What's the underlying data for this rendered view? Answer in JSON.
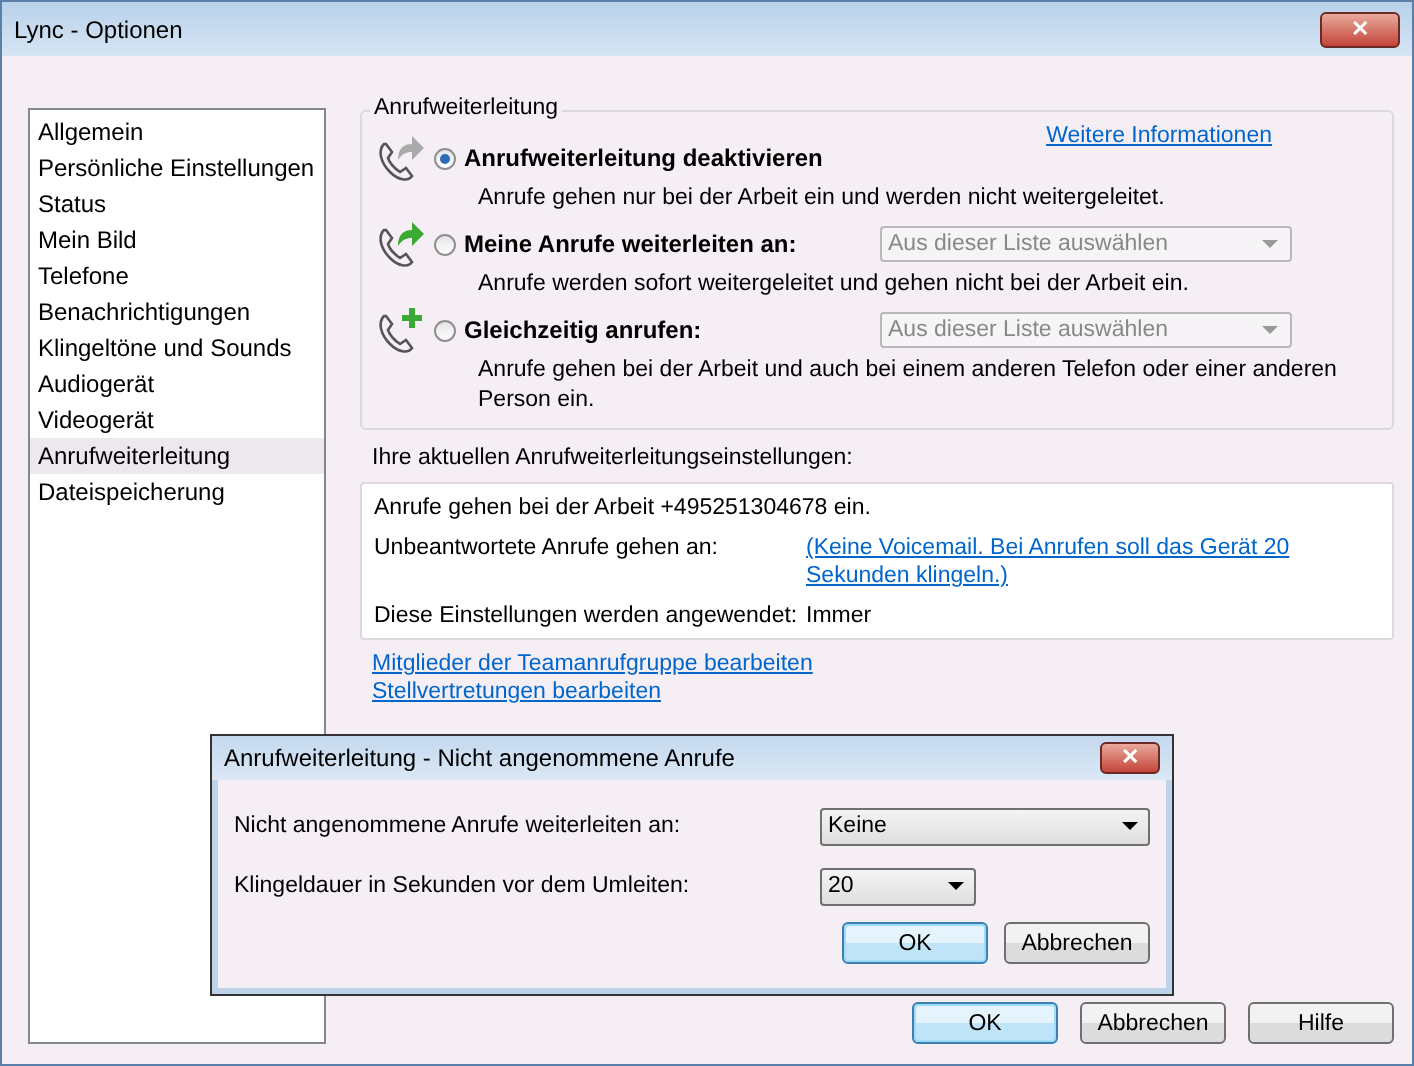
{
  "window": {
    "title": "Lync - Optionen",
    "close": "✕"
  },
  "sidebar": {
    "items": [
      {
        "label": "Allgemein",
        "selected": false
      },
      {
        "label": "Persönliche Einstellungen",
        "selected": false
      },
      {
        "label": "Status",
        "selected": false
      },
      {
        "label": "Mein Bild",
        "selected": false
      },
      {
        "label": "Telefone",
        "selected": false
      },
      {
        "label": "Benachrichtigungen",
        "selected": false
      },
      {
        "label": "Klingeltöne und Sounds",
        "selected": false
      },
      {
        "label": "Audiogerät",
        "selected": false
      },
      {
        "label": "Videogerät",
        "selected": false
      },
      {
        "label": "Anrufweiterleitung",
        "selected": true
      },
      {
        "label": "Dateispeicherung",
        "selected": false
      }
    ]
  },
  "forwarding": {
    "title": "Anrufweiterleitung",
    "more_link": "Weitere Informationen",
    "options": [
      {
        "label": "Anrufweiterleitung deaktivieren",
        "description": "Anrufe gehen nur bei der Arbeit ein und werden nicht weitergeleitet.",
        "selected": true
      },
      {
        "label": "Meine Anrufe weiterleiten an:",
        "description": "Anrufe werden sofort weitergeleitet und gehen nicht bei der Arbeit ein.",
        "selected": false,
        "dropdown": {
          "value": "Aus dieser Liste auswählen",
          "disabled": true
        }
      },
      {
        "label": "Gleichzeitig anrufen:",
        "description": "Anrufe gehen bei der Arbeit und auch bei einem anderen Telefon oder einer anderen Person ein.",
        "selected": false,
        "dropdown": {
          "value": "Aus dieser Liste auswählen",
          "disabled": true
        }
      }
    ]
  },
  "current": {
    "heading": "Ihre aktuellen Anrufweiterleitungseinstellungen:",
    "rows": [
      {
        "kind": "line",
        "text": "Anrufe gehen bei der Arbeit +495251304678 ein."
      },
      {
        "kind": "link",
        "label": "Unbeantwortete Anrufe gehen an:",
        "value": "(Keine Voicemail. Bei Anrufen soll das Gerät 20 Sekunden klingeln.)"
      },
      {
        "kind": "text",
        "label": "Diese Einstellungen werden angewendet:",
        "value": "Immer"
      }
    ]
  },
  "links": [
    "Mitglieder der Teamanrufgruppe bearbeiten",
    "Stellvertretungen bearbeiten"
  ],
  "buttons": [
    {
      "label": "OK",
      "default": true
    },
    {
      "label": "Abbrechen",
      "default": false
    },
    {
      "label": "Hilfe",
      "default": false
    }
  ],
  "dialog": {
    "title": "Anrufweiterleitung - Nicht angenommene Anrufe",
    "close": "✕",
    "fields": [
      {
        "label": "Nicht angenommene Anrufe weiterleiten an:",
        "value": "Keine",
        "kind": "wide"
      },
      {
        "label": "Klingeldauer in Sekunden vor dem Umleiten:",
        "value": "20",
        "kind": "narrow"
      }
    ],
    "buttons": [
      {
        "label": "OK",
        "default": true
      },
      {
        "label": "Abbrechen",
        "default": false
      }
    ]
  }
}
